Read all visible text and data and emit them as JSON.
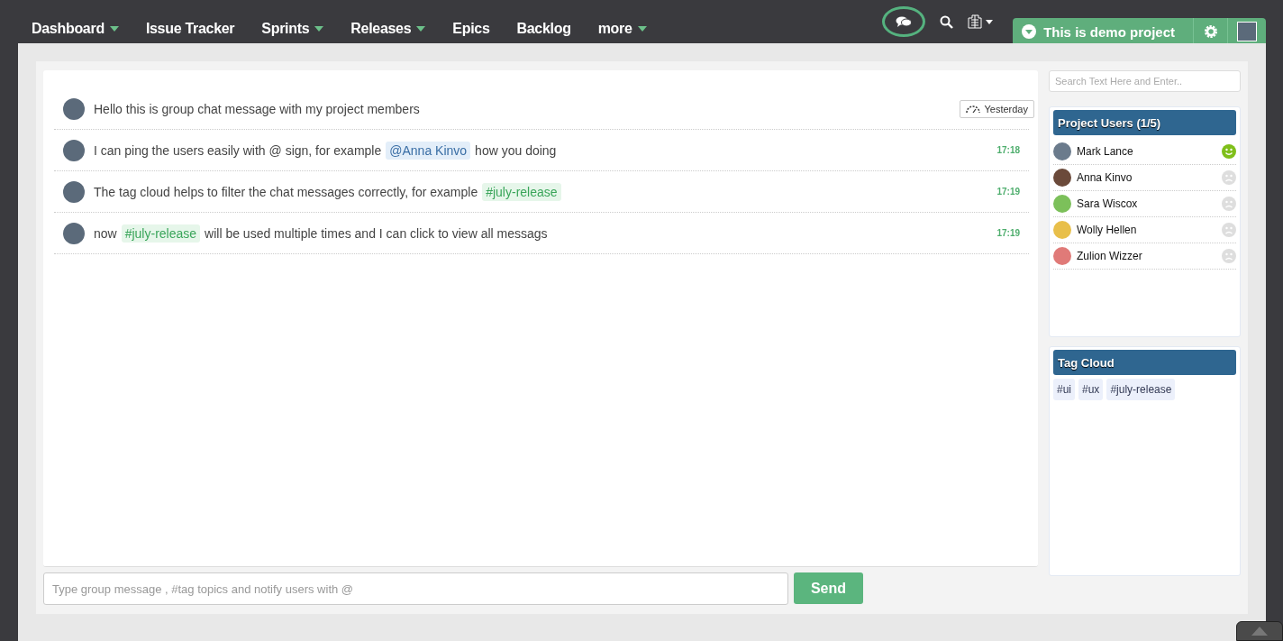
{
  "nav": [
    {
      "label": "Dashboard",
      "dropdown": true
    },
    {
      "label": "Issue Tracker",
      "dropdown": false
    },
    {
      "label": "Sprints",
      "dropdown": true
    },
    {
      "label": "Releases",
      "dropdown": true
    },
    {
      "label": "Epics",
      "dropdown": false
    },
    {
      "label": "Backlog",
      "dropdown": false
    },
    {
      "label": "more",
      "dropdown": true
    }
  ],
  "project": {
    "label": "This is demo project"
  },
  "messages": [
    {
      "time": "Yesterday",
      "kind": "day",
      "parts": [
        {
          "kind": "text",
          "text": "Hello this is group chat message with my project members"
        }
      ]
    },
    {
      "time": "17:18",
      "kind": "clock",
      "parts": [
        {
          "kind": "text",
          "text": "I can ping the users easily with @ sign, for example"
        },
        {
          "kind": "mention",
          "text": "@Anna Kinvo"
        },
        {
          "kind": "text",
          "text": "how you doing"
        }
      ]
    },
    {
      "time": "17:19",
      "kind": "clock",
      "parts": [
        {
          "kind": "text",
          "text": "The tag cloud helps to filter the chat messages correctly, for example"
        },
        {
          "kind": "tag",
          "text": "#july-release"
        }
      ]
    },
    {
      "time": "17:19",
      "kind": "clock",
      "parts": [
        {
          "kind": "text",
          "text": "now"
        },
        {
          "kind": "tag",
          "text": "#july-release"
        },
        {
          "kind": "text",
          "text": "will be used multiple times and I can click to view all messags"
        }
      ]
    }
  ],
  "composer": {
    "placeholder": "Type group message , #tag topics and notify users with @",
    "send": "Send"
  },
  "search": {
    "placeholder": "Search Text Here and Enter.."
  },
  "users_panel": {
    "title": "Project Users (1/5)",
    "users": [
      {
        "name": "Mark Lance",
        "online": true,
        "color": "#6b7b8c"
      },
      {
        "name": "Anna Kinvo",
        "online": false,
        "color": "#6b4a3a"
      },
      {
        "name": "Sara Wiscox",
        "online": false,
        "color": "#7cc05a"
      },
      {
        "name": "Wolly Hellen",
        "online": false,
        "color": "#e8bf4a"
      },
      {
        "name": "Zulion Wizzer",
        "online": false,
        "color": "#e07a78"
      }
    ]
  },
  "tag_cloud": {
    "title": "Tag Cloud",
    "tags": [
      "#ui",
      "#ux",
      "#july-release"
    ]
  }
}
